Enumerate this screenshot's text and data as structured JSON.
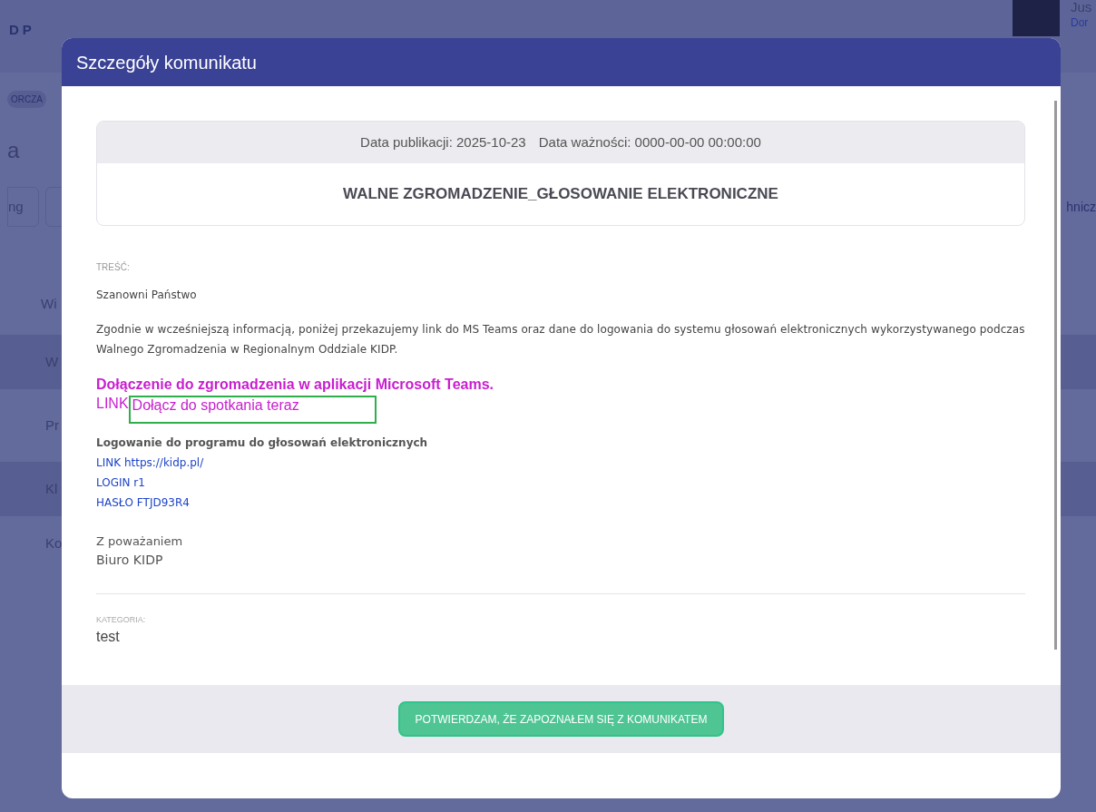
{
  "background": {
    "logo": "DP",
    "badge": "ORCZA",
    "heading": "a",
    "button_label": "ng",
    "right_tab": "hnicz",
    "user_name": "Jus",
    "user_role": "Dor",
    "list_header": "Wi",
    "rows": [
      {
        "label": "W",
        "shaded": true
      },
      {
        "label": "Pr",
        "shaded": false
      },
      {
        "label": "Kl",
        "shaded": true
      },
      {
        "label": "Ko",
        "shaded": false
      }
    ]
  },
  "modal": {
    "title": "Szczegóły komunikatu",
    "publication_date": "Data publikacji: 2025-10-23",
    "expiry_date": "Data ważności: 0000-00-00 00:00:00",
    "subject": "WALNE ZGROMADZENIE_GŁOSOWANIE ELEKTRONICZNE",
    "content_label": "TREŚĆ:",
    "greeting": "Szanowni Państwo",
    "paragraph": "Zgodnie w wcześniejszą informacją, poniżej przekazujemy link do MS Teams oraz dane do logowania do systemu głosowań elektronicznych wykorzystywanego podczas Walnego Zgromadzenia w Regionalnym Oddziale KIDP.",
    "teams_heading": "Dołączenie do zgromadzenia w aplikacji Microsoft Teams.",
    "link_prefix": "LINK",
    "link": {
      "text": "Dołącz do spotkania teraz",
      "focused": true
    },
    "login_heading": "Logowanie do programu do głosowań elektronicznych",
    "login_lines": [
      "LINK https://kidp.pl/",
      "LOGIN r1",
      "HASŁO FTJD93R4"
    ],
    "closing": "Z poważaniem",
    "signature": "Biuro KIDP",
    "category_label": "KATEGORIA:",
    "category": "test",
    "confirm_button": "POTWIERDZAM, ŻE ZAPOZNAŁEM SIĘ Z KOMUNIKATEM"
  }
}
